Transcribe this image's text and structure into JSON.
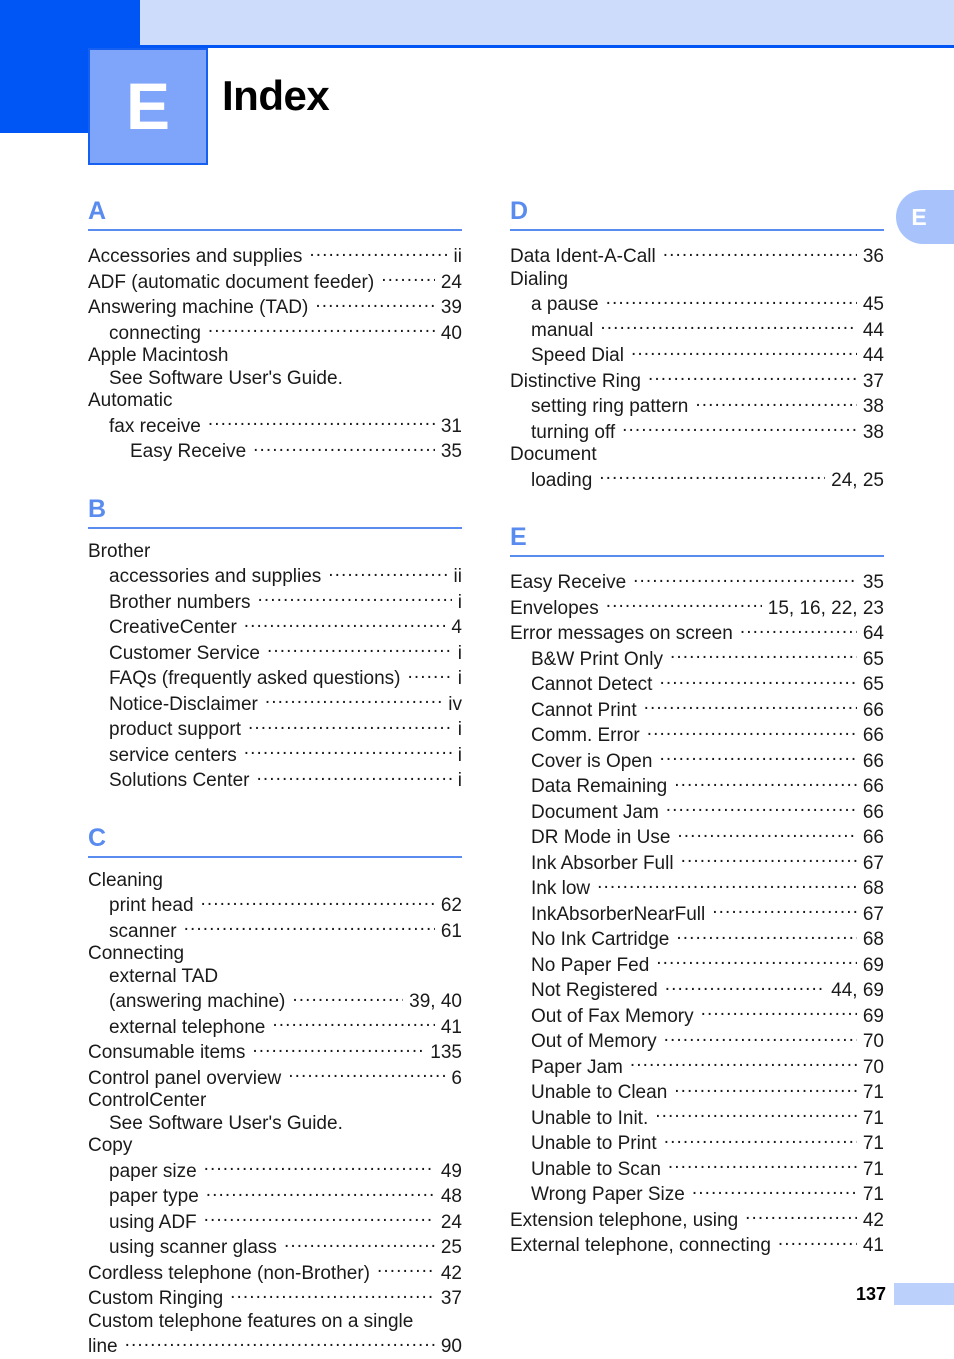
{
  "header": {
    "chapter_letter": "E",
    "title": "Index"
  },
  "edge_tab": {
    "label": "E"
  },
  "footer": {
    "page_number": "137"
  },
  "colors": {
    "band_dark": "#0055F5",
    "band_light": "#CCDCFA",
    "badge": "#7FA5FA",
    "section_letter": "#5A8BEE",
    "edge_tab": "#A8C3FB",
    "footer_block": "#BBD0FB"
  },
  "columns": [
    {
      "sections": [
        {
          "letter": "A",
          "entries": [
            {
              "label": "Accessories and supplies",
              "page": "ii",
              "level": 0
            },
            {
              "label": "ADF (automatic document feeder)",
              "page": "24",
              "level": 0
            },
            {
              "label": "Answering machine (TAD)",
              "page": "39",
              "level": 0
            },
            {
              "label": "connecting",
              "page": "40",
              "level": 1
            },
            {
              "label": "Apple Macintosh",
              "page": "",
              "level": 0
            },
            {
              "label": "See Software User's Guide.",
              "page": "",
              "level": 1
            },
            {
              "label": "Automatic",
              "page": "",
              "level": 0
            },
            {
              "label": "fax receive",
              "page": "31",
              "level": 1
            },
            {
              "label": "Easy Receive",
              "page": "35",
              "level": 2
            }
          ]
        },
        {
          "letter": "B",
          "entries": [
            {
              "label": "Brother",
              "page": "",
              "level": 0
            },
            {
              "label": "accessories and supplies",
              "page": "ii",
              "level": 1
            },
            {
              "label": "Brother numbers",
              "page": "i",
              "level": 1
            },
            {
              "label": "CreativeCenter",
              "page": "4",
              "level": 1
            },
            {
              "label": "Customer Service",
              "page": "i",
              "level": 1
            },
            {
              "label": "FAQs (frequently asked questions)",
              "page": "i",
              "level": 1
            },
            {
              "label": "Notice-Disclaimer",
              "page": "iv",
              "level": 1
            },
            {
              "label": "product support",
              "page": "i",
              "level": 1
            },
            {
              "label": "service centers",
              "page": "i",
              "level": 1
            },
            {
              "label": "Solutions Center",
              "page": "i",
              "level": 1
            }
          ]
        },
        {
          "letter": "C",
          "entries": [
            {
              "label": "Cleaning",
              "page": "",
              "level": 0
            },
            {
              "label": "print head",
              "page": "62",
              "level": 1
            },
            {
              "label": "scanner",
              "page": "61",
              "level": 1
            },
            {
              "label": "Connecting",
              "page": "",
              "level": 0
            },
            {
              "label": "external TAD",
              "page": "",
              "level": 1
            },
            {
              "label": "(answering machine)",
              "page": "39, 40",
              "level": 1
            },
            {
              "label": "external telephone",
              "page": "41",
              "level": 1
            },
            {
              "label": "Consumable items",
              "page": "135",
              "level": 0
            },
            {
              "label": "Control panel overview",
              "page": "6",
              "level": 0
            },
            {
              "label": "ControlCenter",
              "page": "",
              "level": 0
            },
            {
              "label": "See Software User's Guide.",
              "page": "",
              "level": 1
            },
            {
              "label": "Copy",
              "page": "",
              "level": 0
            },
            {
              "label": "paper size",
              "page": "49",
              "level": 1
            },
            {
              "label": "paper type",
              "page": "48",
              "level": 1
            },
            {
              "label": "using ADF",
              "page": "24",
              "level": 1
            },
            {
              "label": "using scanner glass",
              "page": "25",
              "level": 1
            },
            {
              "label": "Cordless telephone (non-Brother)",
              "page": "42",
              "level": 0
            },
            {
              "label": "Custom Ringing",
              "page": "37",
              "level": 0
            },
            {
              "label": "Custom telephone features on a single",
              "page": "",
              "level": 0
            },
            {
              "label": "line",
              "page": "90",
              "level": 0
            }
          ]
        }
      ]
    },
    {
      "sections": [
        {
          "letter": "D",
          "entries": [
            {
              "label": "Data Ident-A-Call",
              "page": "36",
              "level": 0
            },
            {
              "label": "Dialing",
              "page": "",
              "level": 0
            },
            {
              "label": "a pause",
              "page": "45",
              "level": 1
            },
            {
              "label": "manual",
              "page": "44",
              "level": 1
            },
            {
              "label": "Speed Dial",
              "page": "44",
              "level": 1
            },
            {
              "label": "Distinctive Ring",
              "page": "37",
              "level": 0
            },
            {
              "label": "setting ring pattern",
              "page": "38",
              "level": 1
            },
            {
              "label": "turning off",
              "page": "38",
              "level": 1
            },
            {
              "label": "Document",
              "page": "",
              "level": 0
            },
            {
              "label": "loading",
              "page": "24, 25",
              "level": 1
            }
          ]
        },
        {
          "letter": "E",
          "entries": [
            {
              "label": "Easy Receive",
              "page": "35",
              "level": 0
            },
            {
              "label": "Envelopes",
              "page": "15, 16, 22, 23",
              "level": 0
            },
            {
              "label": "Error messages on screen",
              "page": "64",
              "level": 0
            },
            {
              "label": "B&W Print Only",
              "page": "65",
              "level": 1
            },
            {
              "label": "Cannot Detect",
              "page": "65",
              "level": 1
            },
            {
              "label": "Cannot Print",
              "page": "66",
              "level": 1
            },
            {
              "label": "Comm. Error",
              "page": "66",
              "level": 1
            },
            {
              "label": "Cover is Open",
              "page": "66",
              "level": 1
            },
            {
              "label": "Data Remaining",
              "page": "66",
              "level": 1
            },
            {
              "label": "Document Jam",
              "page": "66",
              "level": 1
            },
            {
              "label": "DR Mode in Use",
              "page": "66",
              "level": 1
            },
            {
              "label": "Ink Absorber Full",
              "page": "67",
              "level": 1
            },
            {
              "label": "Ink low",
              "page": "68",
              "level": 1
            },
            {
              "label": "InkAbsorberNearFull",
              "page": "67",
              "level": 1
            },
            {
              "label": "No Ink Cartridge",
              "page": "68",
              "level": 1
            },
            {
              "label": "No Paper Fed",
              "page": "69",
              "level": 1
            },
            {
              "label": "Not Registered",
              "page": "44, 69",
              "level": 1
            },
            {
              "label": "Out of Fax Memory",
              "page": "69",
              "level": 1
            },
            {
              "label": "Out of Memory",
              "page": "70",
              "level": 1
            },
            {
              "label": "Paper Jam",
              "page": "70",
              "level": 1
            },
            {
              "label": "Unable to Clean",
              "page": "71",
              "level": 1
            },
            {
              "label": "Unable to Init.",
              "page": "71",
              "level": 1
            },
            {
              "label": "Unable to Print",
              "page": "71",
              "level": 1
            },
            {
              "label": "Unable to Scan",
              "page": "71",
              "level": 1
            },
            {
              "label": "Wrong Paper Size",
              "page": "71",
              "level": 1
            },
            {
              "label": "Extension telephone, using",
              "page": "42",
              "level": 0
            },
            {
              "label": "External telephone, connecting",
              "page": "41",
              "level": 0
            }
          ]
        }
      ]
    }
  ]
}
